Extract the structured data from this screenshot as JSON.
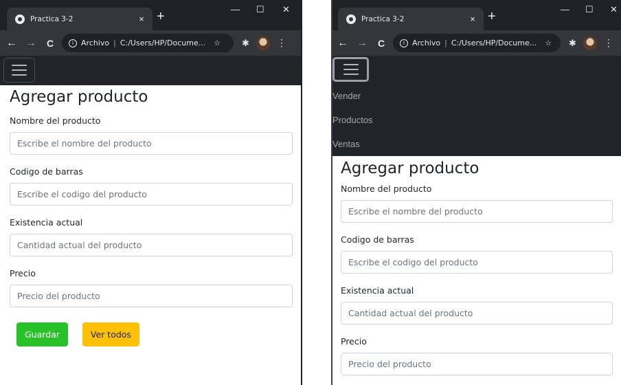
{
  "browser": {
    "tab_title": "Practica 3-2",
    "tab_close": "×",
    "new_tab": "+",
    "minimize": "—",
    "maximize": "☐",
    "close": "✕",
    "address_label": "Archivo",
    "address_path": "C:/Users/HP/Docume...",
    "back": "←",
    "forward": "→",
    "reload": "C",
    "bookmark": "☆",
    "extensions": "✱",
    "menu": "⋮"
  },
  "nav": {
    "links": [
      "Vender",
      "Productos",
      "Ventas"
    ]
  },
  "form": {
    "title": "Agregar producto",
    "fields": [
      {
        "label": "Nombre del producto",
        "placeholder": "Escribe el nombre del producto"
      },
      {
        "label": "Codigo de barras",
        "placeholder": "Escribe el codigo del producto"
      },
      {
        "label": "Existencia actual",
        "placeholder": "Cantidad actual del producto"
      },
      {
        "label": "Precio",
        "placeholder": "Precio del producto"
      }
    ],
    "save_label": "Guardar",
    "view_all_label": "Ver todos"
  },
  "colors": {
    "save_button": "#28c128",
    "view_all_button": "#ffc107",
    "navbar": "#212529"
  }
}
